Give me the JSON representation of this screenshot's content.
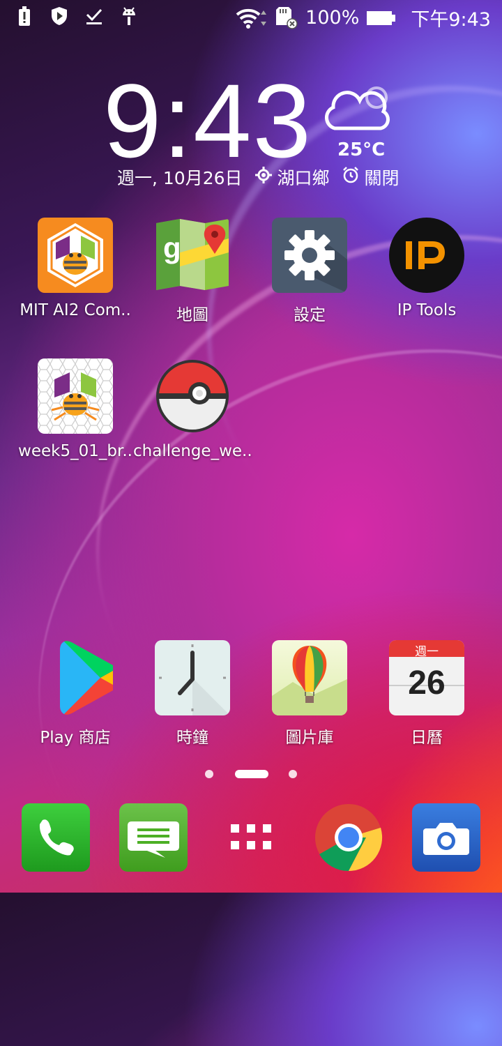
{
  "status_bar": {
    "battery_percent": "100%",
    "time": "下午9:43",
    "icons": [
      "alert-icon",
      "shield-icon",
      "check-download-icon",
      "android-debug-icon",
      "wifi-icon",
      "sd-card-icon",
      "battery-icon"
    ]
  },
  "clock_widget": {
    "time": "9:43",
    "temperature": "25°C",
    "date": "週一, 10月26日",
    "location": "湖口鄉",
    "alarm": "關閉"
  },
  "apps": [
    {
      "label": "MIT AI2 Com..",
      "icon": "mit-ai2-icon"
    },
    {
      "label": "地圖",
      "icon": "maps-icon"
    },
    {
      "label": "設定",
      "icon": "settings-gear-icon"
    },
    {
      "label": "IP Tools",
      "icon": "ip-tools-icon"
    },
    {
      "label": "week5_01_br..",
      "icon": "app-inventor-icon"
    },
    {
      "label": "challenge_we..",
      "icon": "pokeball-icon"
    }
  ],
  "bottom_apps": [
    {
      "label": "Play 商店",
      "icon": "play-store-icon"
    },
    {
      "label": "時鐘",
      "icon": "clock-icon"
    },
    {
      "label": "圖片庫",
      "icon": "gallery-balloon-icon"
    },
    {
      "label": "日曆",
      "icon": "calendar-icon",
      "calendar_weekday": "週一",
      "calendar_day": "26"
    }
  ],
  "dock": [
    "phone-icon",
    "messages-icon",
    "app-drawer-icon",
    "chrome-icon",
    "camera-icon"
  ],
  "colors": {
    "accent_orange": "#f68b1f",
    "settings_bg": "#4a5a6e",
    "phone_green": "#1e9a1e",
    "camera_blue": "#1f62c8"
  }
}
